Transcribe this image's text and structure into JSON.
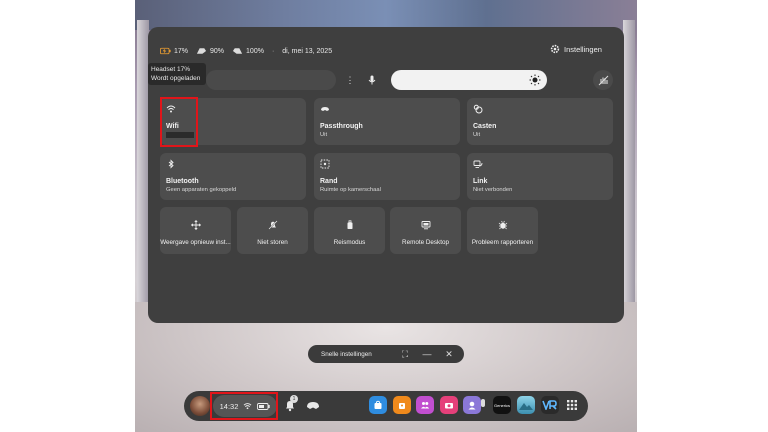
{
  "status": {
    "battery_headset": "17%",
    "controller_left": "90%",
    "controller_right": "100%",
    "date": "di, mei 13, 2025",
    "separator": "·"
  },
  "settings_label": "Instellingen",
  "tooltip": {
    "line1": "Headset 17%",
    "line2": "Wordt opgeladen"
  },
  "tiles": {
    "wifi": {
      "label": "Wifi",
      "sub": ""
    },
    "passthrough": {
      "label": "Passthrough",
      "sub": "Uit"
    },
    "casten": {
      "label": "Casten",
      "sub": "Uit"
    },
    "bluetooth": {
      "label": "Bluetooth",
      "sub": "Geen apparaten gekoppeld"
    },
    "rand": {
      "label": "Rand",
      "sub": "Ruimte op kamerschaal"
    },
    "link": {
      "label": "Link",
      "sub": "Niet verbonden"
    }
  },
  "small_tiles": [
    {
      "label": "Weergave opnieuw inst..."
    },
    {
      "label": "Niet storen"
    },
    {
      "label": "Reismodus"
    },
    {
      "label": "Remote Desktop"
    },
    {
      "label": "Probleem rapporteren"
    }
  ],
  "snelle_label": "Snelle instellingen",
  "taskbar": {
    "time": "14:32",
    "notification_count": "1",
    "apps": [
      {
        "name": "store",
        "color": "#2f8de0"
      },
      {
        "name": "orange-app",
        "color": "#f08a1c"
      },
      {
        "name": "people",
        "color": "#c24fd0"
      },
      {
        "name": "camera",
        "color": "#e5407a"
      },
      {
        "name": "avatar-app",
        "color": "#8b78d8"
      },
      {
        "name": "dark-app",
        "color": "#111111",
        "label": "Generics"
      },
      {
        "name": "landscape-app",
        "color": "#4fb0c8"
      },
      {
        "name": "vr-app",
        "color": "#2a2a2a"
      }
    ]
  },
  "colors": {
    "panel": "#3f3f3f",
    "tile": "#4d4d4d",
    "highlight": "#e0151a"
  }
}
